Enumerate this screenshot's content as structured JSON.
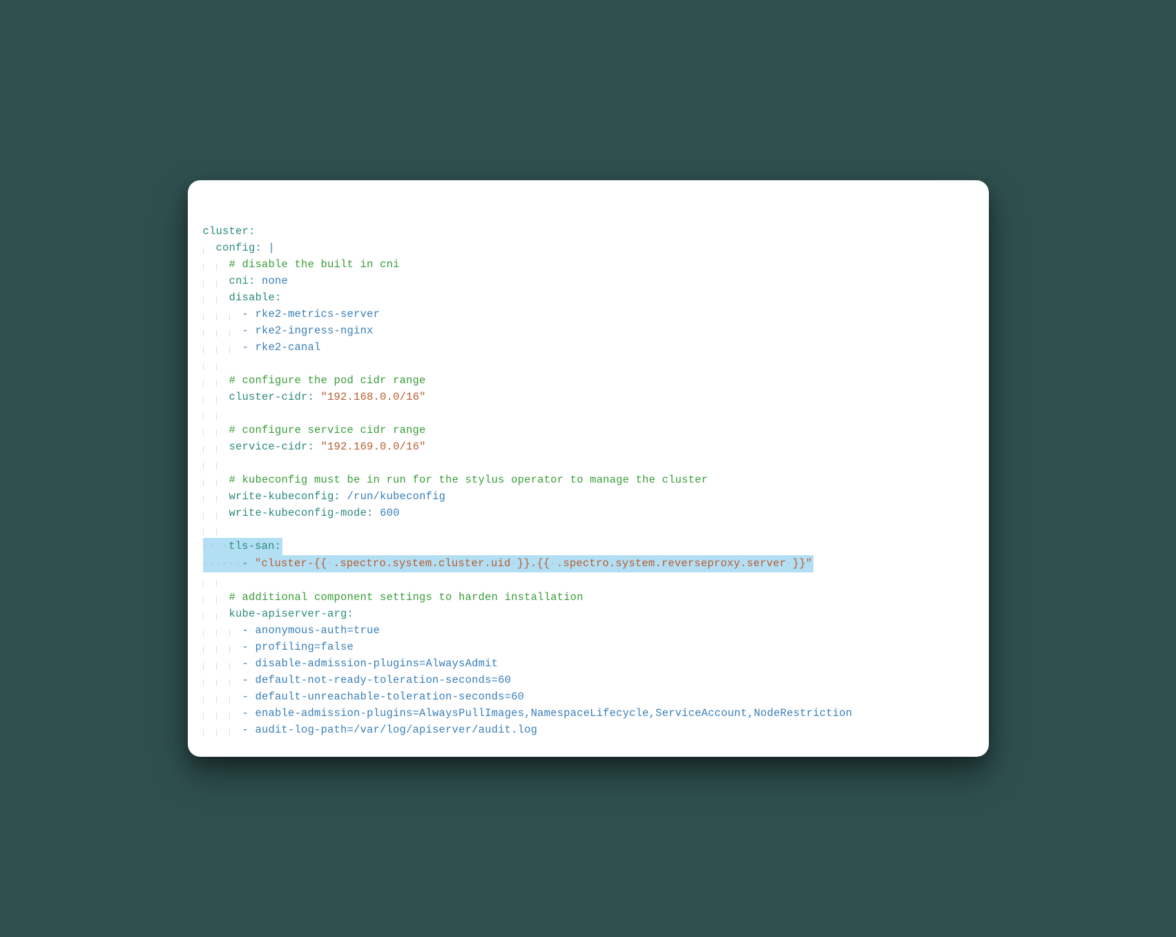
{
  "code": {
    "lines": [
      {
        "indent": 0,
        "type": "key",
        "key": "cluster",
        "suffix": ":"
      },
      {
        "indent": 1,
        "type": "keypipe",
        "key": "config",
        "suffix": ": ",
        "pipe": "|"
      },
      {
        "indent": 2,
        "type": "comment",
        "text": "# disable the built in cni"
      },
      {
        "indent": 2,
        "type": "keyval",
        "key": "cni",
        "sep": ": ",
        "val": "none"
      },
      {
        "indent": 2,
        "type": "key",
        "key": "disable",
        "suffix": ":"
      },
      {
        "indent": 3,
        "type": "listitem",
        "val": "rke2-metrics-server"
      },
      {
        "indent": 3,
        "type": "listitem",
        "val": "rke2-ingress-nginx"
      },
      {
        "indent": 3,
        "type": "listitem",
        "val": "rke2-canal"
      },
      {
        "indent": 2,
        "type": "blank"
      },
      {
        "indent": 2,
        "type": "comment",
        "text": "# configure the pod cidr range"
      },
      {
        "indent": 2,
        "type": "keystr",
        "key": "cluster-cidr",
        "sep": ": ",
        "str": "\"192.168.0.0/16\""
      },
      {
        "indent": 2,
        "type": "blank"
      },
      {
        "indent": 2,
        "type": "comment",
        "text": "# configure service cidr range"
      },
      {
        "indent": 2,
        "type": "keystr",
        "key": "service-cidr",
        "sep": ": ",
        "str": "\"192.169.0.0/16\""
      },
      {
        "indent": 2,
        "type": "blank"
      },
      {
        "indent": 2,
        "type": "comment",
        "text": "# kubeconfig must be in run for the stylus operator to manage the cluster"
      },
      {
        "indent": 2,
        "type": "keyval",
        "key": "write-kubeconfig",
        "sep": ": ",
        "val": "/run/kubeconfig"
      },
      {
        "indent": 2,
        "type": "keyval",
        "key": "write-kubeconfig-mode",
        "sep": ": ",
        "val": "600"
      },
      {
        "indent": 2,
        "type": "blank"
      },
      {
        "indent": 2,
        "type": "hlkey",
        "key": "tls-san",
        "suffix": ":"
      },
      {
        "indent": 3,
        "type": "hlliststr",
        "prefix": "- ",
        "q1": "\"",
        "p1": "cluster-",
        "t1": "{{",
        "ws1": "·",
        "inner1": ".spectro.system.cluster.uid",
        "ws2": "·",
        "t2": "}}",
        "dot": ".",
        "t3": "{{",
        "ws3": "·",
        "inner2": ".spectro.system.reverseproxy.server",
        "ws4": "·",
        "t4": "}}",
        "q2": "\""
      },
      {
        "indent": 2,
        "type": "blank"
      },
      {
        "indent": 2,
        "type": "comment",
        "text": "# additional component settings to harden installation"
      },
      {
        "indent": 2,
        "type": "key",
        "key": "kube-apiserver-arg",
        "suffix": ":"
      },
      {
        "indent": 3,
        "type": "listitem",
        "val": "anonymous-auth=true"
      },
      {
        "indent": 3,
        "type": "listitem",
        "val": "profiling=false"
      },
      {
        "indent": 3,
        "type": "listitem",
        "val": "disable-admission-plugins=AlwaysAdmit"
      },
      {
        "indent": 3,
        "type": "listitem",
        "val": "default-not-ready-toleration-seconds=60"
      },
      {
        "indent": 3,
        "type": "listitem",
        "val": "default-unreachable-toleration-seconds=60"
      },
      {
        "indent": 3,
        "type": "listitem",
        "val": "enable-admission-plugins=AlwaysPullImages,NamespaceLifecycle,ServiceAccount,NodeRestriction"
      },
      {
        "indent": 3,
        "type": "listitem",
        "val": "audit-log-path=/var/log/apiserver/audit.log"
      }
    ]
  }
}
